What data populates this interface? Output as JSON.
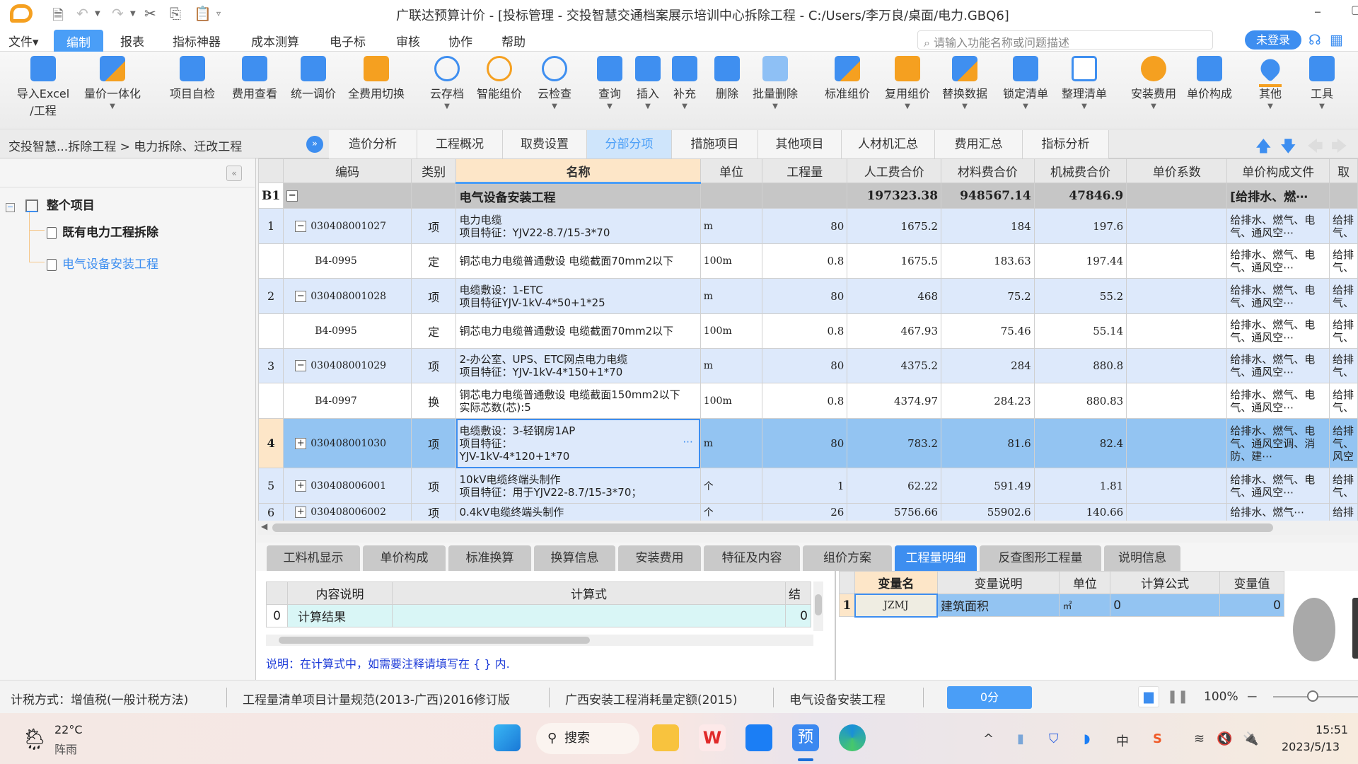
{
  "window": {
    "title": "广联达预算计价 - [投标管理 - 交投智慧交通档案展示培训中心拆除工程 - C:/Users/李万良/桌面/电力.GBQ6]"
  },
  "menu": {
    "items": [
      "文件▾",
      "编制",
      "报表",
      "指标神器",
      "成本测算",
      "电子标",
      "审核",
      "协作",
      "帮助"
    ],
    "active": "编制",
    "search_placeholder": "请输入功能名称或问题描述",
    "login_label": "未登录"
  },
  "ribbon": {
    "tools": [
      {
        "label": "导入Excel",
        "label2": "/工程",
        "icon": "import-excel-icon"
      },
      {
        "label": "量价一体化",
        "icon": "quantity-price-icon"
      },
      {
        "label": "项目自检",
        "icon": "self-check-icon"
      },
      {
        "label": "费用查看",
        "icon": "fee-view-icon"
      },
      {
        "label": "统一调价",
        "icon": "unified-price-icon"
      },
      {
        "label": "全费用切换",
        "icon": "full-fee-switch-icon"
      },
      {
        "label": "云存档",
        "icon": "cloud-archive-icon"
      },
      {
        "label": "智能组价",
        "icon": "smart-pricing-icon"
      },
      {
        "label": "云检查",
        "icon": "cloud-check-icon"
      },
      {
        "label": "查询",
        "icon": "query-icon"
      },
      {
        "label": "插入",
        "icon": "insert-icon"
      },
      {
        "label": "补充",
        "icon": "supplement-icon"
      },
      {
        "label": "删除",
        "icon": "delete-icon"
      },
      {
        "label": "批量删除",
        "icon": "batch-delete-icon"
      },
      {
        "label": "标准组价",
        "icon": "standard-pricing-icon"
      },
      {
        "label": "复用组价",
        "icon": "reuse-pricing-icon"
      },
      {
        "label": "替换数据",
        "icon": "replace-data-icon"
      },
      {
        "label": "锁定清单",
        "icon": "lock-list-icon"
      },
      {
        "label": "整理清单",
        "icon": "organize-list-icon"
      },
      {
        "label": "安装费用",
        "icon": "install-fee-icon"
      },
      {
        "label": "单价构成",
        "icon": "unit-price-icon"
      },
      {
        "label": "其他",
        "icon": "other-icon"
      },
      {
        "label": "工具",
        "icon": "tools-icon"
      }
    ]
  },
  "breadcrumb": "交投智慧...拆除工程 > 电力拆除、迁改工程",
  "page_tabs": [
    "造价分析",
    "工程概况",
    "取费设置",
    "分部分项",
    "措施项目",
    "其他项目",
    "人材机汇总",
    "费用汇总",
    "指标分析"
  ],
  "active_page_tab": "分部分项",
  "tree": {
    "root": "整个项目",
    "children": [
      "既有电力工程拆除",
      "电气设备安装工程"
    ],
    "selected": "电气设备安装工程"
  },
  "grid": {
    "columns": [
      "",
      "编码",
      "类别",
      "名称",
      "单位",
      "工程量",
      "人工费合价",
      "材料费合价",
      "机械费合价",
      "单价系数",
      "单价构成文件",
      "取"
    ],
    "section": {
      "no": "B1",
      "name": "电气设备安装工程",
      "labor": "197323.38",
      "material": "948567.14",
      "machine": "47846.9",
      "file": "[给排水、燃⋯"
    },
    "rows": [
      {
        "no": "1",
        "code": "030408001027",
        "type": "项",
        "name": "电力电缆\n项目特征：YJV22-8.7/15-3*70",
        "unit": "m",
        "qty": "80",
        "labor": "1675.2",
        "material": "184",
        "machine": "197.6",
        "coef": "",
        "file": "给排水、燃气、电气、通风空⋯",
        "extra": "给排气、",
        "kind": "qd",
        "exp": "−"
      },
      {
        "no": "",
        "code": "B4-0995",
        "type": "定",
        "name": "铜芯电力电缆普通敷设 电缆截面70mm2以下",
        "unit": "100m",
        "qty": "0.8",
        "labor": "1675.5",
        "material": "183.63",
        "machine": "197.44",
        "coef": "",
        "file": "给排水、燃气、电气、通风空⋯",
        "extra": "给排气、",
        "kind": "de",
        "exp": ""
      },
      {
        "no": "2",
        "code": "030408001028",
        "type": "项",
        "name": "电缆敷设：1-ETC\n项目特征YJV-1kV-4*50+1*25",
        "unit": "m",
        "qty": "80",
        "labor": "468",
        "material": "75.2",
        "machine": "55.2",
        "coef": "",
        "file": "给排水、燃气、电气、通风空⋯",
        "extra": "给排气、",
        "kind": "qd",
        "exp": "−"
      },
      {
        "no": "",
        "code": "B4-0995",
        "type": "定",
        "name": "铜芯电力电缆普通敷设 电缆截面70mm2以下",
        "unit": "100m",
        "qty": "0.8",
        "labor": "467.93",
        "material": "75.46",
        "machine": "55.14",
        "coef": "",
        "file": "给排水、燃气、电气、通风空⋯",
        "extra": "给排气、",
        "kind": "de",
        "exp": ""
      },
      {
        "no": "3",
        "code": "030408001029",
        "type": "项",
        "name": "2-办公室、UPS、ETC网点电力电缆\n项目特征：YJV-1kV-4*150+1*70",
        "unit": "m",
        "qty": "80",
        "labor": "4375.2",
        "material": "284",
        "machine": "880.8",
        "coef": "",
        "file": "给排水、燃气、电气、通风空⋯",
        "extra": "给排气、",
        "kind": "qd",
        "exp": "−"
      },
      {
        "no": "",
        "code": "B4-0997",
        "type": "换",
        "name": "铜芯电力电缆普通敷设 电缆截面150mm2以下　实际芯数(芯):5",
        "unit": "100m",
        "qty": "0.8",
        "labor": "4374.97",
        "material": "284.23",
        "machine": "880.83",
        "coef": "",
        "file": "给排水、燃气、电气、通风空⋯",
        "extra": "给排气、",
        "kind": "de",
        "exp": ""
      },
      {
        "no": "4",
        "code": "030408001030",
        "type": "项",
        "name": "电缆敷设：3-轻钢房1AP\n项目特征：\nYJV-1kV-4*120+1*70",
        "unit": "m",
        "qty": "80",
        "labor": "783.2",
        "material": "81.6",
        "machine": "82.4",
        "coef": "",
        "file": "给排水、燃气、电气、通风空调、消防、建⋯",
        "extra": "给排气、风空",
        "kind": "sel",
        "exp": "+"
      },
      {
        "no": "5",
        "code": "030408006001",
        "type": "项",
        "name": "10kV电缆终端头制作\n项目特征：用于YJV22-8.7/15-3*70；",
        "unit": "个",
        "qty": "1",
        "labor": "62.22",
        "material": "591.49",
        "machine": "1.81",
        "coef": "",
        "file": "给排水、燃气、电气、通风空⋯",
        "extra": "给排气、",
        "kind": "qd",
        "exp": "+"
      },
      {
        "no": "6",
        "code": "030408006002",
        "type": "项",
        "name": "0.4kV电缆终端头制作",
        "unit": "个",
        "qty": "26",
        "labor": "5756.66",
        "material": "55902.6",
        "machine": "140.66",
        "coef": "",
        "file": "给排水、燃气⋯",
        "extra": "给排",
        "kind": "qd",
        "exp": "+"
      }
    ]
  },
  "bottom_tabs": [
    "工料机显示",
    "单价构成",
    "标准换算",
    "换算信息",
    "安装费用",
    "特征及内容",
    "组价方案",
    "工程量明细",
    "反查图形工程量",
    "说明信息"
  ],
  "active_bottom_tab": "工程量明细",
  "calc": {
    "columns": [
      "",
      "内容说明",
      "计算式",
      "结"
    ],
    "rows": [
      {
        "no": "0",
        "desc": "计算结果",
        "formula": "",
        "result": "0"
      }
    ],
    "note": "说明：在计算式中，如需要注释请填写在 { } 内."
  },
  "variables": {
    "columns": [
      "",
      "变量名",
      "变量说明",
      "单位",
      "计算公式",
      "变量值"
    ],
    "rows": [
      {
        "no": "1",
        "name": "JZMJ",
        "desc": "建筑面积",
        "unit": "㎡",
        "formula": "0",
        "value": "0"
      }
    ]
  },
  "status": {
    "tax": "计税方式：增值税(一般计税方法)",
    "spec": "工程量清单项目计量规范(2013-广西)2016修订版",
    "quota": "广西安装工程消耗量定额(2015)",
    "section": "电气设备安装工程",
    "score": "0分",
    "zoom": "100%"
  },
  "taskbar": {
    "weather_temp": "22°C",
    "weather_desc": "阵雨",
    "search_label": "搜索",
    "ime": "中",
    "time": "15:51",
    "date": "2023/5/13"
  }
}
